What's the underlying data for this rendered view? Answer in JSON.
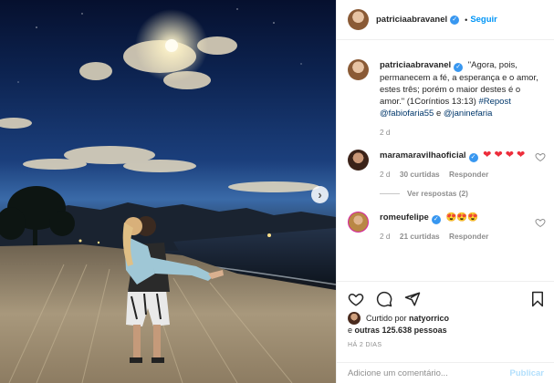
{
  "post": {
    "username": "patriciaabravanel",
    "follow_label": "Seguir",
    "dot": "•",
    "verified_glyph": "✓",
    "next_arrow": "›"
  },
  "caption": {
    "username": "patriciaabravanel",
    "text": "\"Agora, pois, permanecem a fé, a esperança e o amor, estes três; porém o maior destes é o amor.\" (1Coríntios 13:13)",
    "hashtag": "#Repost",
    "mention1": "@fabiofaria55",
    "conj": "e",
    "mention2": "@janinefaria",
    "age": "2 d"
  },
  "comments": [
    {
      "username": "maramaravilhaoficial",
      "text": "❤ ❤ ❤ ❤",
      "age": "2 d",
      "likes": "30 curtidas",
      "reply_label": "Responder",
      "view_replies": "Ver respostas (2)"
    },
    {
      "username": "romeufelipe",
      "text": "😍😍😍",
      "age": "2 d",
      "likes": "21 curtidas",
      "reply_label": "Responder"
    }
  ],
  "likes": {
    "prefix": "Curtido por",
    "user": "natyorrico",
    "conj": "e",
    "others": "outras 125.638 pessoas"
  },
  "timestamp": "HÁ 2 DIAS",
  "add_comment": {
    "placeholder": "Adicione um comentário...",
    "post_label": "Publicar"
  },
  "icons": [
    "heart-icon",
    "comment-icon",
    "share-icon",
    "bookmark-icon",
    "verified-icon",
    "chevron-right-icon"
  ],
  "colors": {
    "link": "#00376b",
    "follow": "#0095f6",
    "verified": "#3897f0",
    "muted": "#8e8e8e"
  }
}
